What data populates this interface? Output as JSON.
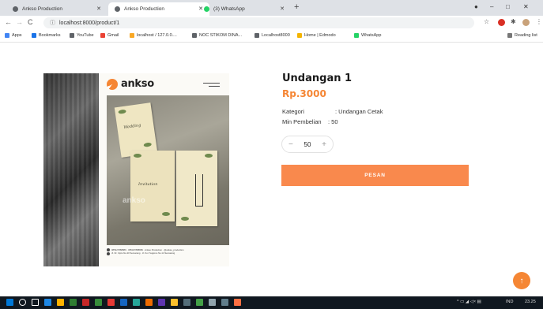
{
  "browser": {
    "tabs": [
      {
        "title": "Ankso Production",
        "favicon_color": "#5f6368"
      },
      {
        "title": "Ankso Production",
        "favicon_color": "#5f6368"
      },
      {
        "title": "(3) WhatsApp",
        "favicon_color": "#25d366"
      }
    ],
    "new_tab_label": "+",
    "window_controls": [
      "–",
      "□",
      "✕"
    ],
    "url": "localhost:8000/product/1",
    "bookmarks": [
      {
        "label": "Apps",
        "color": "#4285f4"
      },
      {
        "label": "Bookmarks",
        "color": "#1a73e8"
      },
      {
        "label": "YouTube",
        "color": "#5f6368"
      },
      {
        "label": "Gmail",
        "color": "#ea4335"
      },
      {
        "label": "localhost / 127.0.0....",
        "color": "#f9a825"
      },
      {
        "label": "NOC STIKOM DINA...",
        "color": "#5f6368"
      },
      {
        "label": "Localhost8000",
        "color": "#5f6368"
      },
      {
        "label": "Home | Edmodo",
        "color": "#f4b400"
      },
      {
        "label": "WhatsApp",
        "color": "#25d366"
      }
    ],
    "reading_list": "Reading list"
  },
  "product": {
    "image_card": {
      "logo_text": "ankso",
      "watermark": "ankso",
      "footer_lines": [
        "085327888889 · 085327888889 · Ankso Production · @ankso_production",
        "Jl. Dr. Cipto No.20 Semarang · Jl. Kol. Sugiono No.14 Semarang"
      ]
    },
    "title": "Undangan 1",
    "price": "Rp.3000",
    "details": [
      {
        "key": "Kategori",
        "value": ": Undangan Cetak"
      },
      {
        "key": "Min Pembelian",
        "value": ": 50"
      }
    ],
    "quantity": {
      "minus": "−",
      "value": "50",
      "plus": "+"
    },
    "order_button": "PESAN"
  },
  "fab": {
    "icon": "arrow-up-icon",
    "glyph": "↑"
  },
  "taskbar": {
    "apps": [
      "#0078d7",
      "#ffffff",
      "#ffffff",
      "#1e88e5",
      "#ffb300",
      "#2e7d32",
      "#c62828",
      "#388e3c",
      "#e53935",
      "#1565c0",
      "#26a69a",
      "#ef6c00",
      "#5e35b1",
      "#fbc02d",
      "#546e7a",
      "#43a047",
      "#ff7043"
    ],
    "lang": "IND",
    "time": "23.25"
  },
  "colors": {
    "accent": "#f58634",
    "button": "#f9894d",
    "text": "#1a1a1a"
  }
}
